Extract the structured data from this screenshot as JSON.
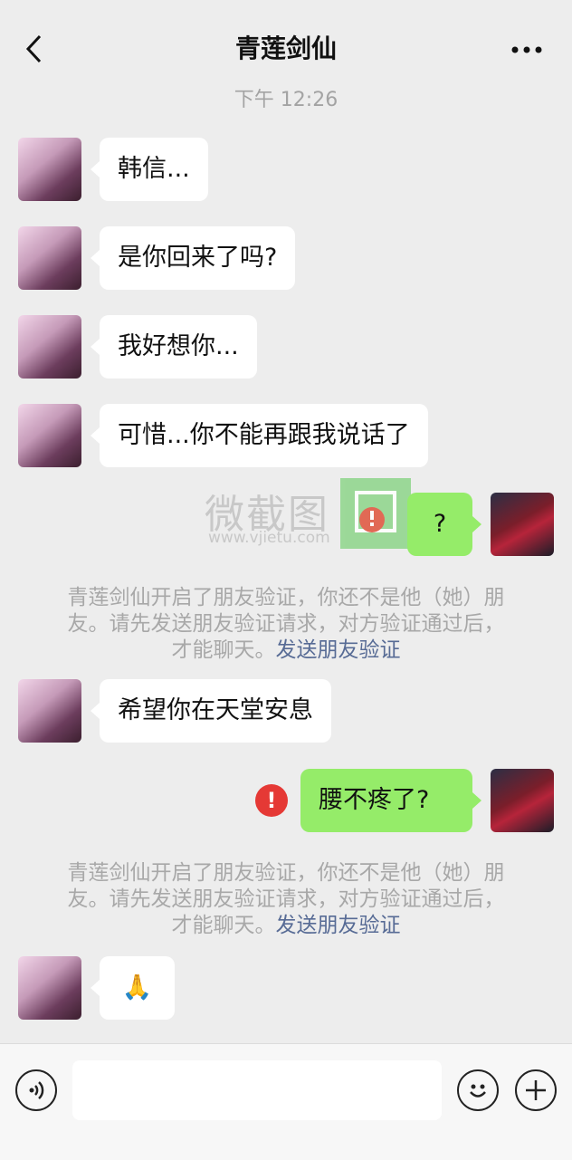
{
  "header": {
    "title": "青莲剑仙",
    "back_icon": "chevron-left-icon",
    "more_icon": "more-dots-icon"
  },
  "timestamp": "下午 12:26",
  "messages": [
    {
      "side": "left",
      "text": "韩信..."
    },
    {
      "side": "left",
      "text": "是你回来了吗?"
    },
    {
      "side": "left",
      "text": "我好想你..."
    },
    {
      "side": "left",
      "text": "可惜...你不能再跟我说话了"
    },
    {
      "side": "right",
      "text": "?"
    },
    {
      "side": "left",
      "text": "希望你在天堂安息"
    },
    {
      "side": "right",
      "text": "腰不疼了?",
      "status": "failed"
    },
    {
      "side": "left",
      "text": "🙏"
    }
  ],
  "notice": {
    "line1": "青莲剑仙开启了朋友验证，你还不是他（她）朋",
    "line2": "友。请先发送朋友验证请求，对方验证通过后，",
    "line3": "才能聊天。",
    "link": "发送朋友验证"
  },
  "watermark": {
    "text": "微截图",
    "url": "www.vjietu.com"
  },
  "footer": {
    "voice_icon": "voice-icon",
    "emoji_icon": "emoji-icon",
    "plus_icon": "plus-icon",
    "input_value": ""
  },
  "colors": {
    "background": "#ededed",
    "bubble_left": "#ffffff",
    "bubble_right": "#95ec69",
    "link": "#576b95",
    "error": "#e53935"
  }
}
